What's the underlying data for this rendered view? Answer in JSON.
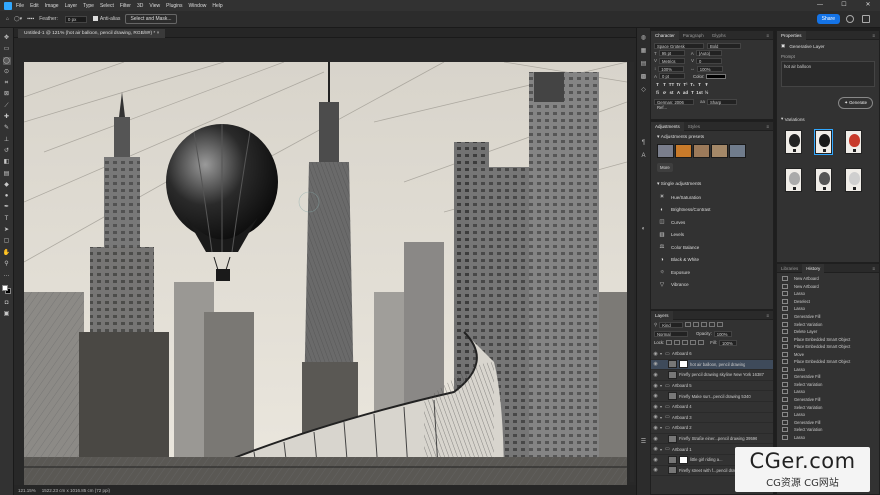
{
  "app": {
    "name": "Adobe Photoshop",
    "brand_color": "#31a8ff"
  },
  "menubar": {
    "items": [
      "File",
      "Edit",
      "Image",
      "Layer",
      "Type",
      "Select",
      "Filter",
      "3D",
      "View",
      "Plugins",
      "Window",
      "Help"
    ],
    "window_controls": [
      "—",
      "☐",
      "✕"
    ]
  },
  "options": {
    "feather_label": "Feather:",
    "feather_value": "0 px",
    "antialias_label": "Anti-alias",
    "select_mask_label": "Select and Mask...",
    "share_label": "Share"
  },
  "document": {
    "tab_title": "Untitled-1 @ 121% (hot air balloon, pencil drawing, RGB/8#) *",
    "close_glyph": "×",
    "status_zoom": "121.15%",
    "status_info": "1522.23 cm x 1016.85 cm (72 ppi)"
  },
  "character": {
    "tabs": [
      "Character",
      "Paragraph",
      "Glyphs"
    ],
    "font_family": "Space Grotesk",
    "font_style": "Bold",
    "font_size": "95 pt",
    "leading": "(Auto)",
    "kerning": "Metrics",
    "tracking": "0",
    "vscale": "100%",
    "hscale": "100%",
    "baseline": "0 pt",
    "color_label": "Color:",
    "format_buttons": [
      "T",
      "T",
      "TT",
      "Tr",
      "T¹",
      "T₁",
      "T",
      "Ŧ"
    ],
    "opentype_buttons": [
      "fi",
      "ơ",
      "st",
      "A",
      "ad",
      "T",
      "1st",
      "½"
    ],
    "language": "German: 2006 Ref...",
    "aa_label": "aa",
    "antialias": "Sharp"
  },
  "adjustments": {
    "tabs": [
      "Adjustments",
      "Styles"
    ],
    "presets_label": "Adjustments presets",
    "more_label": "More",
    "single_label": "Single adjustments",
    "items": [
      {
        "icon": "☀",
        "label": "Hue/Saturation"
      },
      {
        "icon": "◐",
        "label": "Brightness/Contrast"
      },
      {
        "icon": "◫",
        "label": "Curves"
      },
      {
        "icon": "▥",
        "label": "Levels"
      },
      {
        "icon": "⚖",
        "label": "Color Balance"
      },
      {
        "icon": "◑",
        "label": "Black & White"
      },
      {
        "icon": "☼",
        "label": "Exposure"
      },
      {
        "icon": "▽",
        "label": "Vibrance"
      }
    ],
    "preset_colors": [
      "#7a7e8c",
      "#c87a2a",
      "#9c7a5a",
      "#a48868",
      "#707c8c"
    ]
  },
  "layers": {
    "tab": "Layers",
    "filter_kind": "Kind",
    "blend_mode": "Normal",
    "opacity_label": "Opacity:",
    "opacity": "100%",
    "lock_label": "Lock:",
    "fill_label": "Fill:",
    "fill": "100%",
    "rows": [
      {
        "type": "group",
        "name": "Artboard 6",
        "selected": false
      },
      {
        "type": "layer",
        "name": "hot air balloon, pencil drawing",
        "selected": true,
        "mask": true
      },
      {
        "type": "layer",
        "name": "Firefly pencil drawing skyline New York 16387",
        "selected": false,
        "mask": false
      },
      {
        "type": "group",
        "name": "Artboard 5",
        "selected": false
      },
      {
        "type": "layer",
        "name": "Firefly Make surr...pencil drawing 5340",
        "selected": false,
        "mask": false
      },
      {
        "type": "group",
        "name": "Artboard 4",
        "selected": false
      },
      {
        "type": "group",
        "name": "Artboard 3",
        "selected": false
      },
      {
        "type": "group",
        "name": "Artboard 2",
        "selected": false
      },
      {
        "type": "layer",
        "name": "Firefly Straße einer...pencil drawing 39596",
        "selected": false,
        "mask": false
      },
      {
        "type": "group",
        "name": "Artboard 1",
        "selected": false
      },
      {
        "type": "layer",
        "name": "little girl riding a...",
        "selected": false,
        "mask": true
      },
      {
        "type": "layer",
        "name": "Firefly street with f...pencil drawing",
        "selected": false,
        "mask": false
      }
    ]
  },
  "properties": {
    "tab": "Properties",
    "layer_type": "Generative Layer",
    "prompt_label": "Prompt",
    "prompt": "hot air balloon",
    "generate_label": "Generate",
    "variations_label": "Variations",
    "variation_colors": [
      "#222222",
      "#1a1a1a",
      "#c83a2a",
      "#aaaaaa",
      "#555555",
      "#cfcfcf"
    ]
  },
  "history": {
    "tabs": [
      "Libraries",
      "History"
    ],
    "items": [
      "New Artboard",
      "New Artboard",
      "Lasso",
      "Deselect",
      "Lasso",
      "Generative Fill",
      "Select Variation",
      "Delete Layer",
      "Place Embedded Smart Object",
      "Place Embedded Smart Object",
      "Move",
      "Place Embedded Smart Object",
      "Lasso",
      "Generative Fill",
      "Select Variation",
      "Lasso",
      "Generative Fill",
      "Select Variation",
      "Lasso",
      "Generative Fill",
      "Select Variation",
      "Lasso"
    ]
  },
  "watermark": {
    "line1": "CGer.com",
    "line2": "CG资源 CG网站"
  }
}
